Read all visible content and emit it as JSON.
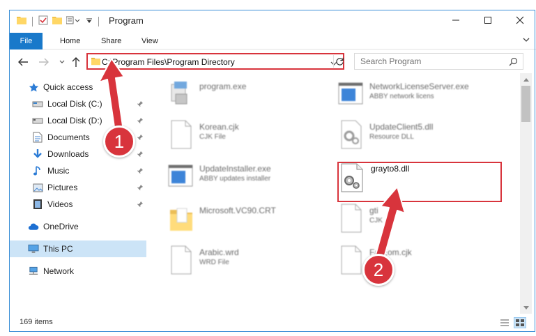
{
  "window": {
    "title": "Program",
    "minimize": "—",
    "maximize": "☐",
    "close": "✕"
  },
  "ribbon": {
    "tabs": [
      "File",
      "Home",
      "Share",
      "View"
    ]
  },
  "address": {
    "path": "C:\\Program Files\\Program Directory"
  },
  "search": {
    "placeholder": "Search Program"
  },
  "nav": {
    "quick_access": "Quick access",
    "items": [
      {
        "label": "Local Disk (C:)",
        "icon": "drive-icon"
      },
      {
        "label": "Local Disk (D:)",
        "icon": "drive-icon"
      },
      {
        "label": "Documents",
        "icon": "documents-icon"
      },
      {
        "label": "Downloads",
        "icon": "downloads-icon"
      },
      {
        "label": "Music",
        "icon": "music-icon"
      },
      {
        "label": "Pictures",
        "icon": "pictures-icon"
      },
      {
        "label": "Videos",
        "icon": "videos-icon"
      }
    ],
    "onedrive": "OneDrive",
    "this_pc": "This PC",
    "network": "Network"
  },
  "files": [
    {
      "name": "program.exe",
      "type": "",
      "icon": "exe-icon"
    },
    {
      "name": "NetworkLicenseServer.exe",
      "type": "ABBY network licens",
      "icon": "app-window-icon"
    },
    {
      "name": "Korean.cjk",
      "type": "CJK File",
      "icon": "blank-file-icon"
    },
    {
      "name": "UpdateClient5.dll",
      "type": "Resource DLL",
      "icon": "dll-icon"
    },
    {
      "name": "UpdateInstaller.exe",
      "type": "ABBY updates installer",
      "icon": "app-window-icon"
    },
    {
      "name": "grayto8.dll",
      "type": "",
      "icon": "dll-icon"
    },
    {
      "name": "Microsoft.VC90.CRT",
      "type": "",
      "icon": "folder-icon"
    },
    {
      "name": "gti",
      "type": "CJK",
      "icon": "blank-file-icon"
    },
    {
      "name": "Arabic.wrd",
      "type": "WRD File",
      "icon": "blank-file-icon"
    },
    {
      "name": "FarEom.cjk",
      "type": "File",
      "icon": "blank-file-icon"
    }
  ],
  "status": {
    "items_count": "169 items"
  },
  "markers": {
    "step1": "1",
    "step2": "2"
  },
  "colors": {
    "accent": "#1979ca",
    "highlight": "#d8343c",
    "selected": "#cce4f7"
  }
}
